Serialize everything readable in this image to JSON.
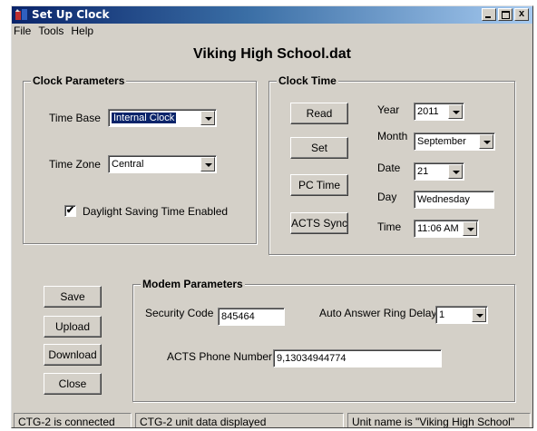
{
  "window": {
    "title": "Set Up Clock",
    "caption_close": "x"
  },
  "menu": [
    "File",
    "Tools",
    "Help"
  ],
  "document_title": "Viking High School.dat",
  "clock_parameters": {
    "group_label": "Clock Parameters",
    "time_base_label": "Time Base",
    "time_base_value": "Internal Clock",
    "time_zone_label": "Time Zone",
    "time_zone_value": "Central",
    "dst_label": "Daylight Saving Time Enabled",
    "dst_checked": true,
    "check_mark": "✔"
  },
  "clock_time": {
    "group_label": "Clock Time",
    "buttons": {
      "read": "Read",
      "set": "Set",
      "pc_time": "PC Time",
      "acts_sync": "ACTS Sync"
    },
    "year_label": "Year",
    "year_value": "2011",
    "month_label": "Month",
    "month_value": "September",
    "date_label": "Date",
    "date_value": "21",
    "day_label": "Day",
    "day_value": "Wednesday",
    "time_label": "Time",
    "time_value": "11:06 AM"
  },
  "actions": {
    "save": "Save",
    "upload": "Upload",
    "download": "Download",
    "close": "Close"
  },
  "modem_parameters": {
    "group_label": "Modem Parameters",
    "security_code_label": "Security Code",
    "security_code_value": "845464",
    "ring_delay_label": "Auto Answer Ring Delay",
    "ring_delay_value": "1",
    "acts_phone_label": "ACTS Phone Number",
    "acts_phone_value": "9,13034944774"
  },
  "status": {
    "connection": "CTG-2 is connected",
    "data": "CTG-2 unit data displayed",
    "unit_name": "Unit name is \"Viking High School\""
  },
  "colors": {
    "titlebar_start": "#0a246a",
    "titlebar_end": "#a6caf0",
    "face": "#d4d0c8",
    "selection": "#0a246a"
  }
}
